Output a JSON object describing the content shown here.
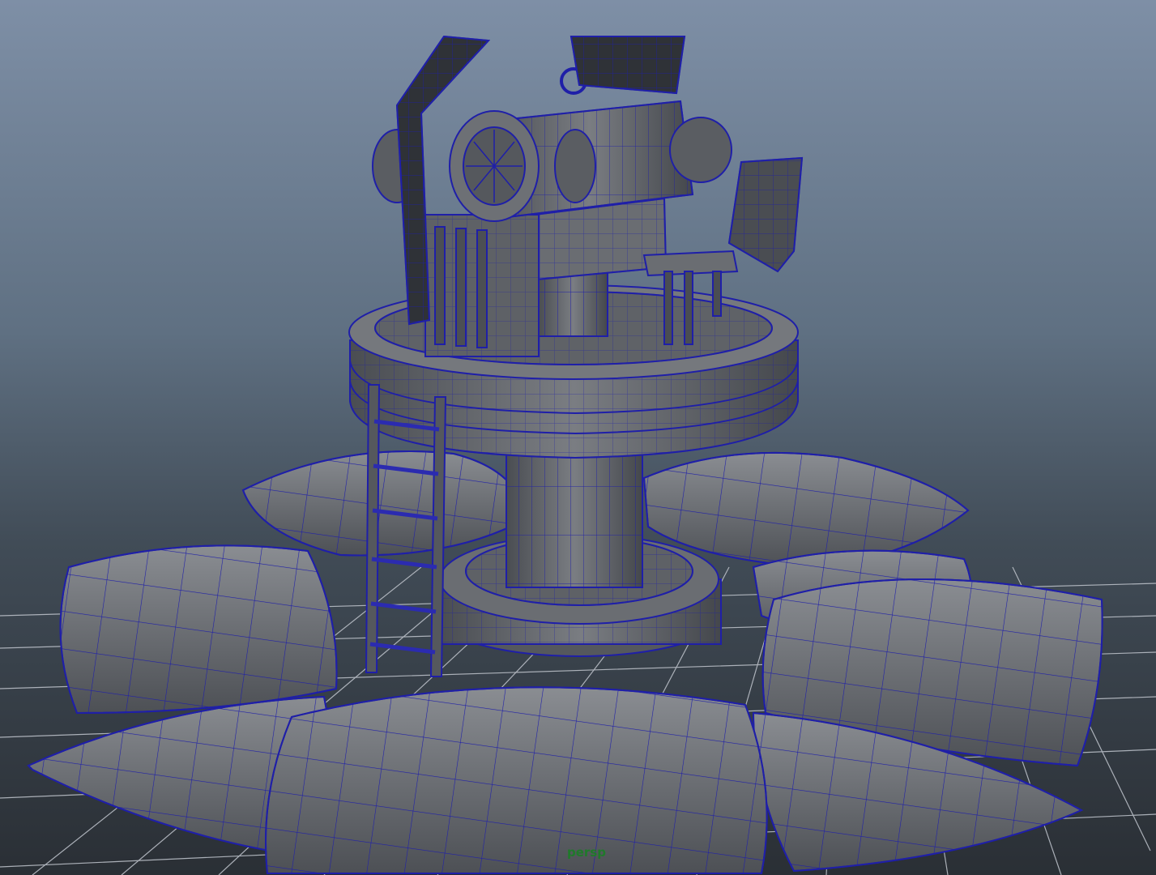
{
  "viewport": {
    "camera_label": "persp",
    "background_top": "#7e8fa6",
    "background_bottom": "#2a2f35",
    "wireframe_color": "#1f1fa8",
    "shaded_color": "#6b6e74",
    "grid_color": "#b9bec6"
  },
  "scene": {
    "objects": [
      "ground-grid",
      "sandbag-ring",
      "tower-base-ring",
      "support-column",
      "upper-platform",
      "ladder",
      "turret-body",
      "turret-barrel",
      "turret-shield-left",
      "turret-shield-right",
      "gunner-seat"
    ]
  }
}
